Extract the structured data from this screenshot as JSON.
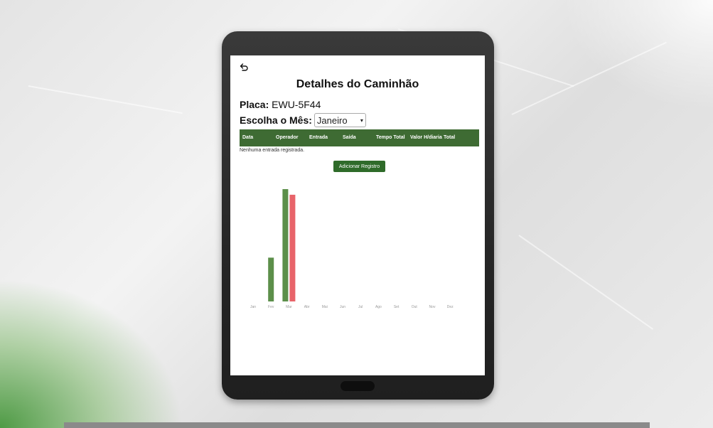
{
  "screen": {
    "title": "Detalhes do Caminhão",
    "plate_label": "Placa:",
    "plate_value": "EWU-5F44",
    "month_label": "Escolha o Mês:",
    "month_selected": "Janeiro"
  },
  "table": {
    "columns": [
      "Data",
      "Operador",
      "Entrada",
      "Saída",
      "Tempo Total",
      "Valor H/diaria",
      "Total"
    ],
    "empty_message": "Nenhuma entrada registrada."
  },
  "add_button_label": "Adicionar Registro",
  "colors": {
    "header_green": "#3e6b33",
    "bar_green": "#5c8f4a",
    "bar_red": "#e8646a",
    "button_green": "#2f6b2a"
  },
  "icons": {
    "back": "undo-arrow-icon"
  },
  "chart_data": {
    "type": "bar",
    "categories": [
      "Jan",
      "Fev",
      "Mar",
      "Abr",
      "Mai",
      "Jun",
      "Jul",
      "Ago",
      "Set",
      "Out",
      "Nov",
      "Dez"
    ],
    "series": [
      {
        "values": [
          0,
          0.39,
          1.0,
          0,
          0,
          0,
          0,
          0,
          0,
          0,
          0,
          0
        ],
        "color": "#5c8f4a"
      },
      {
        "values": [
          0,
          0,
          0.95,
          0,
          0,
          0,
          0,
          0,
          0,
          0,
          0,
          0
        ],
        "color": "#e8646a"
      }
    ],
    "title": "",
    "xlabel": "",
    "ylabel": "",
    "ylim": [
      0,
      1
    ],
    "grid": false
  }
}
